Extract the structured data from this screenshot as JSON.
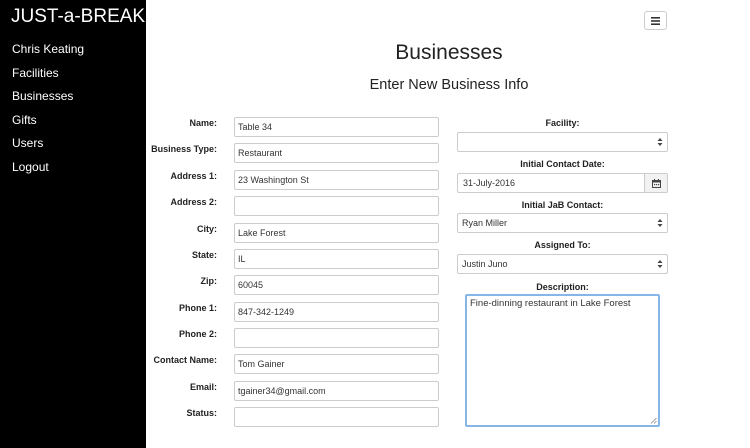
{
  "sidebar": {
    "brand": "JUST-a-BREAK",
    "items": [
      {
        "label": "Chris Keating"
      },
      {
        "label": "Facilities"
      },
      {
        "label": "Businesses"
      },
      {
        "label": "Gifts"
      },
      {
        "label": "Users"
      },
      {
        "label": "Logout"
      }
    ]
  },
  "header": {
    "menu_icon": "hamburger-icon",
    "title": "Businesses",
    "subtitle": "Enter New Business Info"
  },
  "form": {
    "left": [
      {
        "label": "Name:",
        "value": "Table 34"
      },
      {
        "label": "Business Type:",
        "value": "Restaurant"
      },
      {
        "label": "Address 1:",
        "value": "23 Washington St"
      },
      {
        "label": "Address 2:",
        "value": ""
      },
      {
        "label": "City:",
        "value": "Lake Forest"
      },
      {
        "label": "State:",
        "value": "IL"
      },
      {
        "label": "Zip:",
        "value": "60045"
      },
      {
        "label": "Phone 1:",
        "value": "847-342-1249"
      },
      {
        "label": "Phone 2:",
        "value": ""
      },
      {
        "label": "Contact Name:",
        "value": "Tom Gainer"
      },
      {
        "label": "Email:",
        "value": "tgainer34@gmail.com"
      },
      {
        "label": "Status:",
        "value": ""
      }
    ],
    "facility": {
      "label": "Facility:",
      "value": ""
    },
    "initial_contact_date": {
      "label": "Initial Contact Date:",
      "value": "31-July-2016",
      "icon": "calendar-icon"
    },
    "initial_jab_contact": {
      "label": "Initial JaB Contact:",
      "value": "Ryan Miller"
    },
    "assigned_to": {
      "label": "Assigned To:",
      "value": "Justin Juno"
    },
    "description": {
      "label": "Description:",
      "value": "Fine-dinning restaurant in Lake Forest"
    }
  },
  "colors": {
    "sidebar_bg": "#000000",
    "focus_border": "#84b6e8"
  }
}
